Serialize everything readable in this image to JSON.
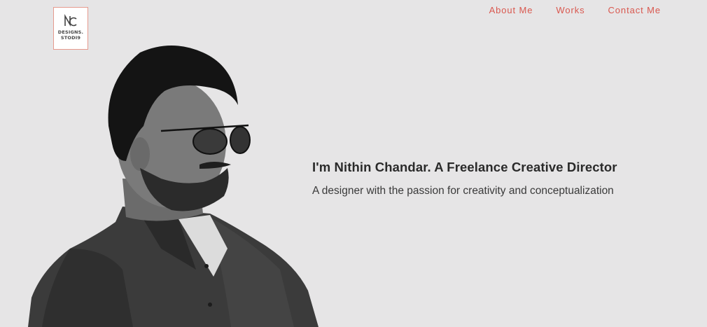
{
  "logo": {
    "line1": "DESIGNS.",
    "line2": "STODI9",
    "mark": "NC"
  },
  "nav": {
    "items": [
      {
        "label": "About Me"
      },
      {
        "label": "Works"
      },
      {
        "label": "Contact Me"
      }
    ]
  },
  "hero": {
    "title": "I'm Nithin Chandar. A Freelance Creative Director",
    "subtitle": "A designer with the passion for creativity and conceptualization"
  },
  "portrait": {
    "icon": "person-photo"
  },
  "colors": {
    "background": "#e6e5e6",
    "accent": "#d9584f",
    "text": "#2a2a2a"
  }
}
